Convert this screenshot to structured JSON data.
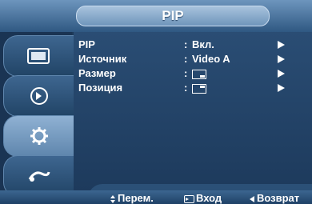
{
  "menu": {
    "title": "PIP"
  },
  "rows": [
    {
      "label": "PIP",
      "value": "Вкл."
    },
    {
      "label": "Источник",
      "value": "Video A"
    },
    {
      "label": "Размер",
      "value": ""
    },
    {
      "label": "Позиция",
      "value": ""
    }
  ],
  "help": {
    "move": "Перем.",
    "enter": "Вход",
    "back": "Возврат"
  },
  "sidebar": {
    "tabs": [
      {
        "icon": "picture-icon",
        "active": false
      },
      {
        "icon": "sound-icon",
        "active": false
      },
      {
        "icon": "gear-icon",
        "active": true
      },
      {
        "icon": "input-icon",
        "active": false
      }
    ]
  },
  "colors": {
    "title_bar": "#6d95bd",
    "panel": "#2a4d74",
    "active_tab": "#8fb1d3"
  }
}
